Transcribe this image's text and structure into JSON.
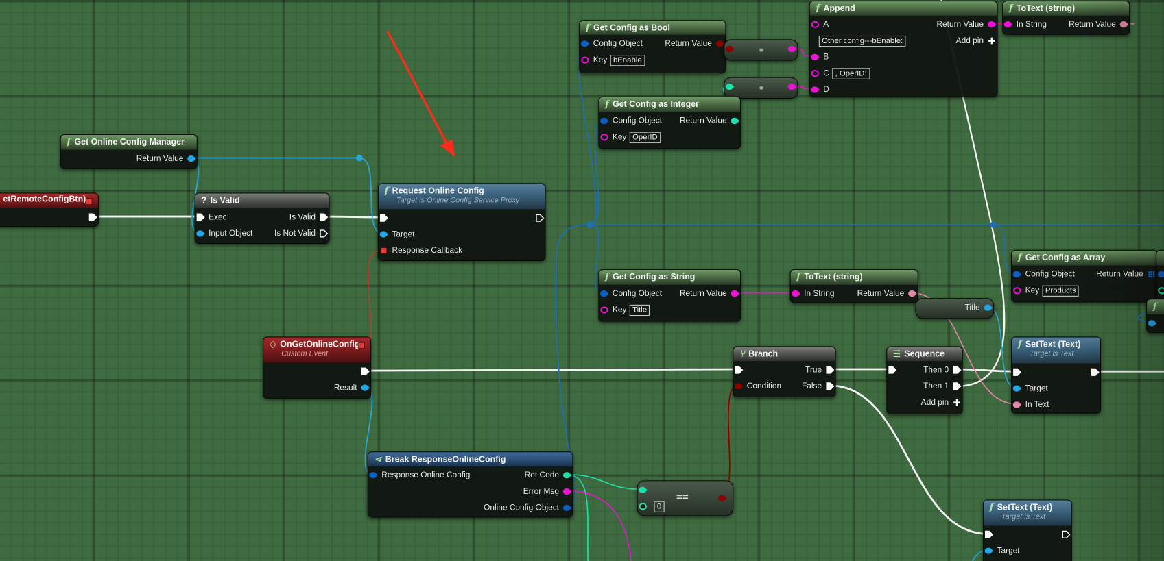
{
  "colors": {
    "exec": "#ffffff",
    "object": "#22a6e8",
    "object_dark": "#0d5fc2",
    "string": "#f010d8",
    "text": "#e486a8",
    "int": "#1fe0aa",
    "bool": "#8c0000",
    "delegate": "#e83a3a",
    "wire_object": "#2aa6dc",
    "wire_red": "#c03a30",
    "annotation_arrow": "#ff2a1a"
  },
  "nodes": [
    {
      "id": "gr",
      "kind": "event",
      "title": "etRemoteConfigBtn)",
      "header_pin": "delegate",
      "rows": [
        {
          "r": {
            "t": "exec"
          }
        }
      ]
    },
    {
      "id": "gocm",
      "kind": "function",
      "icon": "f",
      "title": "Get Online Config Manager",
      "rows": [
        {
          "r": {
            "label": "Return Value",
            "t": "object"
          }
        }
      ]
    },
    {
      "id": "isvalid",
      "kind": "grey",
      "icon": "?",
      "title": "Is Valid",
      "rows": [
        {
          "l": {
            "label": "Exec",
            "t": "exec"
          },
          "r": {
            "label": "Is Valid",
            "t": "exec"
          }
        },
        {
          "l": {
            "label": "Input Object",
            "t": "object"
          },
          "r": {
            "label": "Is Not Valid",
            "t": "exec",
            "hollow": true
          }
        }
      ]
    },
    {
      "id": "request",
      "kind": "blue",
      "icon": "f",
      "title": "Request Online Config",
      "subtitle": "Target is Online Config Service Proxy",
      "rows": [
        {
          "l": {
            "t": "exec"
          },
          "r": {
            "t": "exec",
            "hollow": true
          }
        },
        {
          "l": {
            "label": "Target",
            "t": "object"
          }
        },
        {
          "l": {
            "label": "Response Callback",
            "t": "delegate"
          }
        }
      ]
    },
    {
      "id": "onget",
      "kind": "event",
      "icon": "◇",
      "title": "OnGetOnlineConfig",
      "subtitle": "Custom Event",
      "header_pin": "delegate",
      "rows": [
        {
          "r": {
            "t": "exec"
          }
        },
        {
          "r": {
            "label": "Result",
            "t": "object"
          }
        }
      ]
    },
    {
      "id": "brk",
      "kind": "struct",
      "icon": "⋖",
      "title": "Break ResponseOnlineConfig",
      "rows": [
        {
          "l": {
            "label": "Response Online Config",
            "t": "object_dark"
          },
          "r": {
            "label": "Ret Code",
            "t": "int"
          }
        },
        {
          "r": {
            "label": "Error Msg",
            "t": "string"
          }
        },
        {
          "r": {
            "label": "Online Config Object",
            "t": "object_dark"
          }
        }
      ]
    },
    {
      "id": "eq",
      "kind": "compact",
      "title": "==",
      "rows": [
        {
          "l": {
            "t": "int"
          }
        },
        {
          "l": {
            "t": "int",
            "hollow": true,
            "value": "0"
          }
        }
      ],
      "output": {
        "t": "bool"
      }
    },
    {
      "id": "bool",
      "kind": "function",
      "icon": "f",
      "title": "Get Config as Bool",
      "rows": [
        {
          "l": {
            "label": "Config Object",
            "t": "object_dark"
          },
          "r": {
            "label": "Return Value",
            "t": "bool"
          }
        },
        {
          "l": {
            "label": "Key",
            "t": "string",
            "hollow": true,
            "value": "bEnable"
          }
        }
      ]
    },
    {
      "id": "conv1",
      "kind": "compact",
      "rows": [
        {
          "l": {
            "t": "bool"
          },
          "r": {
            "t": "string"
          }
        }
      ]
    },
    {
      "id": "conv2",
      "kind": "compact",
      "rows": [
        {
          "l": {
            "t": "int"
          },
          "r": {
            "t": "string"
          }
        }
      ]
    },
    {
      "id": "append",
      "kind": "function",
      "icon": "f",
      "title": "Append",
      "rows": [
        {
          "l": {
            "label": "A",
            "t": "string",
            "hollow": true
          },
          "r": {
            "label": "Return Value",
            "t": "string"
          }
        },
        {
          "l": {
            "value": "Other config---bEnable:"
          },
          "r": {
            "label": "Add pin",
            "t": "add"
          }
        },
        {
          "l": {
            "label": "B",
            "t": "string"
          }
        },
        {
          "l": {
            "label": "C",
            "t": "string",
            "hollow": true,
            "value": ", OperID:"
          }
        },
        {
          "l": {
            "label": "D",
            "t": "string"
          }
        }
      ]
    },
    {
      "id": "totext1",
      "kind": "function",
      "icon": "f",
      "title": "ToText (string)",
      "rows": [
        {
          "l": {
            "label": "In String",
            "t": "string"
          },
          "r": {
            "label": "Return Value",
            "t": "text"
          }
        }
      ]
    },
    {
      "id": "int",
      "kind": "function",
      "icon": "f",
      "title": "Get Config as Integer",
      "rows": [
        {
          "l": {
            "label": "Config Object",
            "t": "object_dark"
          },
          "r": {
            "label": "Return Value",
            "t": "int"
          }
        },
        {
          "l": {
            "label": "Key",
            "t": "string",
            "hollow": true,
            "value": "OperID"
          }
        }
      ]
    },
    {
      "id": "string",
      "kind": "function",
      "icon": "f",
      "title": "Get Config as String",
      "rows": [
        {
          "l": {
            "label": "Config Object",
            "t": "object_dark"
          },
          "r": {
            "label": "Return Value",
            "t": "string"
          }
        },
        {
          "l": {
            "label": "Key",
            "t": "string",
            "hollow": true,
            "value": "Title"
          }
        }
      ]
    },
    {
      "id": "totext2",
      "kind": "function",
      "icon": "f",
      "title": "ToText (string)",
      "rows": [
        {
          "l": {
            "label": "In String",
            "t": "string"
          },
          "r": {
            "label": "Return Value",
            "t": "text"
          }
        }
      ]
    },
    {
      "id": "titlevar",
      "kind": "compact",
      "rows": [
        {
          "r": {
            "label": "Title",
            "t": "object"
          }
        }
      ]
    },
    {
      "id": "array",
      "kind": "function",
      "icon": "f",
      "title": "Get Config as Array",
      "rows": [
        {
          "l": {
            "label": "Config Object",
            "t": "object_dark"
          },
          "r": {
            "label": "Return Value",
            "t": "array"
          }
        },
        {
          "l": {
            "label": "Key",
            "t": "string",
            "hollow": true,
            "value": "Products"
          }
        }
      ]
    },
    {
      "id": "clip1",
      "kind": "function",
      "title": "",
      "rows": [
        {
          "l": {
            "t": "object_dark"
          }
        },
        {
          "l": {
            "t": "int",
            "hollow": true
          }
        }
      ]
    },
    {
      "id": "clip2",
      "kind": "function",
      "icon": "f",
      "title": "",
      "rows": [
        {
          "l": {
            "t": "object"
          }
        }
      ]
    },
    {
      "id": "branch",
      "kind": "grey",
      "icon": "⑂",
      "title": "Branch",
      "rows": [
        {
          "l": {
            "t": "exec"
          },
          "r": {
            "label": "True",
            "t": "exec"
          }
        },
        {
          "l": {
            "label": "Condition",
            "t": "bool"
          },
          "r": {
            "label": "False",
            "t": "exec"
          }
        }
      ]
    },
    {
      "id": "seq",
      "kind": "grey",
      "icon": "⇶",
      "title": "Sequence",
      "rows": [
        {
          "l": {
            "t": "exec"
          },
          "r": {
            "label": "Then 0",
            "t": "exec"
          }
        },
        {
          "r": {
            "label": "Then 1",
            "t": "exec"
          }
        },
        {
          "r": {
            "label": "Add pin",
            "t": "add"
          }
        }
      ]
    },
    {
      "id": "settext1",
      "kind": "blue",
      "icon": "f",
      "title": "SetText (Text)",
      "subtitle": "Target is Text",
      "rows": [
        {
          "l": {
            "t": "exec"
          },
          "r": {
            "t": "exec"
          }
        },
        {
          "l": {
            "label": "Target",
            "t": "object"
          }
        },
        {
          "l": {
            "label": "In Text",
            "t": "text"
          }
        }
      ]
    },
    {
      "id": "settext2",
      "kind": "blue",
      "icon": "f",
      "title": "SetText (Text)",
      "subtitle": "Target is Text",
      "rows": [
        {
          "l": {
            "t": "exec"
          },
          "r": {
            "t": "exec",
            "hollow": true
          }
        },
        {
          "l": {
            "label": "Target",
            "t": "object"
          }
        }
      ]
    }
  ]
}
